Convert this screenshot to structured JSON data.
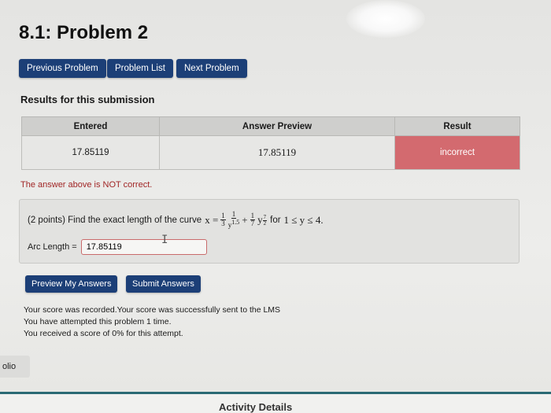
{
  "page": {
    "title": "8.1: Problem 2"
  },
  "nav": {
    "previous": "Previous Problem",
    "list": "Problem List",
    "next": "Next Problem"
  },
  "results": {
    "heading": "Results for this submission",
    "columns": [
      "Entered",
      "Answer Preview",
      "Result"
    ],
    "row": {
      "entered": "17.85119",
      "preview": "17.85119",
      "result": "incorrect"
    },
    "result_color": "#d36a6f",
    "message": "The answer above is NOT correct."
  },
  "problem": {
    "points": "(2 points) Find the exact length of the curve",
    "equation": {
      "lhs": "x =",
      "f1_num": "1",
      "f1_den": "3",
      "f2_num": "1",
      "f2_den": "y",
      "f2_exp": "1.5",
      "plus": "+",
      "f3_num": "1",
      "f3_den": "7",
      "var": "y",
      "exp_num": "7",
      "exp_den": "2"
    },
    "range_prefix": "for",
    "range": "1 ≤ y ≤ 4.",
    "answer_label": "Arc Length =",
    "answer_value": "17.85119"
  },
  "actions": {
    "preview": "Preview My Answers",
    "submit": "Submit Answers"
  },
  "status": {
    "line1": "Your score was recorded.Your score was successfully sent to the LMS",
    "line2": "You have attempted this problem 1 time.",
    "line3": "You received a score of 0% for this attempt."
  },
  "side_tab": "olio",
  "footer": {
    "activity": "Activity Details"
  },
  "colors": {
    "button": "#1c3f77",
    "error_text": "#a12626"
  },
  "icons": {
    "cursor": "text-cursor-icon"
  }
}
